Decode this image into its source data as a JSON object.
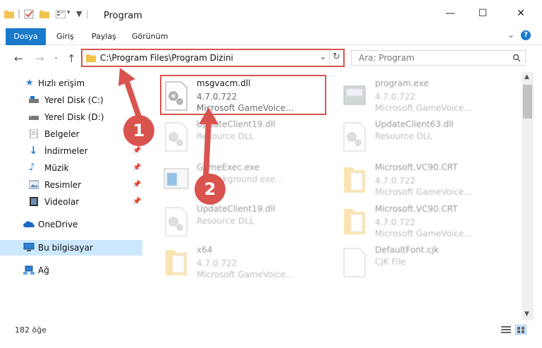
{
  "window": {
    "title": "Program",
    "minimize_glyph": "—",
    "maximize_glyph": "☐",
    "close_glyph": "✕"
  },
  "ribbon": {
    "tabs": [
      "Dosya",
      "Giriş",
      "Paylaş",
      "Görünüm"
    ],
    "help_glyph": "?",
    "expand_glyph": "⌄"
  },
  "address": {
    "path": "C:\\Program Files\\Program Dizini",
    "search_placeholder": "Ara: Program"
  },
  "sidebar": {
    "items": [
      {
        "label": "Hızlı erişim",
        "icon": "star-icon",
        "pinned": false
      },
      {
        "label": "Yerel Disk (C:)",
        "icon": "drive-c-icon",
        "pinned": false
      },
      {
        "label": "Yerel Disk (D:)",
        "icon": "drive-d-icon",
        "pinned": false
      },
      {
        "label": "Belgeler",
        "icon": "documents-icon",
        "pinned": false
      },
      {
        "label": "İndirmeler",
        "icon": "downloads-icon",
        "pinned": true
      },
      {
        "label": "Müzik",
        "icon": "music-icon",
        "pinned": true
      },
      {
        "label": "Resimler",
        "icon": "pictures-icon",
        "pinned": true
      },
      {
        "label": "Videolar",
        "icon": "videos-icon",
        "pinned": true
      },
      {
        "label": "OneDrive",
        "icon": "onedrive-icon",
        "pinned": false
      },
      {
        "label": "Bu bilgisayar",
        "icon": "this-pc-icon",
        "pinned": false,
        "selected": true
      },
      {
        "label": "Ağ",
        "icon": "network-icon",
        "pinned": false
      }
    ]
  },
  "files": [
    {
      "name": "msgvacm.dll",
      "version": "4.7.0.722",
      "desc": "Microsoft GameVoice...",
      "icon": "dll-gear-icon",
      "highlight": true
    },
    {
      "name": "program.exe",
      "version": "4.7.0.722",
      "desc": "Microsoft GameVoice...",
      "icon": "exe-icon"
    },
    {
      "name": "UpdateClient19.dll",
      "version": "",
      "desc": "Resource DLL",
      "icon": "dll-gear-icon"
    },
    {
      "name": "UpdateClient63.dll",
      "version": "",
      "desc": "Resource DLL",
      "icon": "dll-gear-icon"
    },
    {
      "name": "GameExec.exe",
      "version": "",
      "desc": "... background exe...",
      "icon": "exe-window-icon"
    },
    {
      "name": "Microsoft.VC90.CRT",
      "version": "4.7.0.722",
      "desc": "Microsoft GameVoice...",
      "icon": "folder-icon"
    },
    {
      "name": "UpdateClient19.dll",
      "version": "",
      "desc": "Resource DLL",
      "icon": "dll-gear-icon"
    },
    {
      "name": "Microsoft.VC90.CRT",
      "version": "4.7.0.722",
      "desc": "Microsoft GameVoice...",
      "icon": "folder-icon"
    },
    {
      "name": "x64",
      "version": "4.7.0.722",
      "desc": "Microsoft GameVoice...",
      "icon": "folder-icon"
    },
    {
      "name": "DefaultFont.cjk",
      "version": "",
      "desc": "CJK File",
      "icon": "file-icon"
    }
  ],
  "status": {
    "count_text": "182 öğe"
  },
  "callouts": [
    "1",
    "2"
  ],
  "colors": {
    "accent": "#1979ca",
    "highlight_red": "#d9534f",
    "selection_bg": "#cce8ff"
  }
}
